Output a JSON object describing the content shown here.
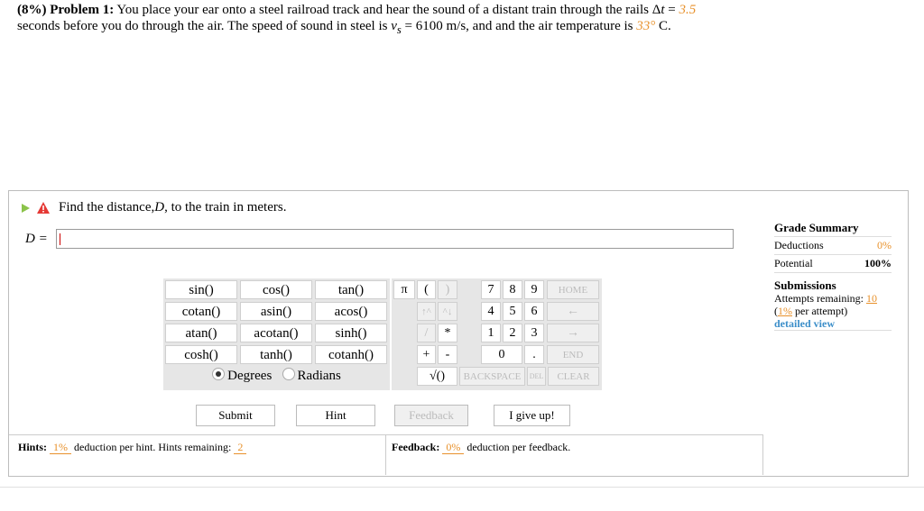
{
  "problem": {
    "weight": "(8%)",
    "label": "Problem 1:",
    "text1": "You place your ear onto a steel railroad track and hear the sound of a distant train through the rails Δ",
    "dt_var": "t",
    "eq1": " = ",
    "dt_value": "3.5",
    "text2": "seconds before you do through the air. The speed of sound in steel is ",
    "vs_var": "v",
    "vs_sub": "s",
    "text3": " = 6100 m/s, and and the air temperature is ",
    "temp_value": "33°",
    "text4": " C."
  },
  "question": {
    "text_before": "Find the distance, ",
    "var": "D",
    "text_after": ", to the train in meters.",
    "answer_label": "D =",
    "answer_value": ""
  },
  "grade_summary": {
    "title": "Grade Summary",
    "deductions_label": "Deductions",
    "deductions_value": "0%",
    "potential_label": "Potential",
    "potential_value": "100%"
  },
  "submissions": {
    "title": "Submissions",
    "attempts_label": "Attempts remaining:",
    "attempts_value": "10",
    "per_attempt_open": "(",
    "per_attempt_value": "1%",
    "per_attempt_rest": " per attempt)",
    "detail_link": "detailed view"
  },
  "functions": [
    [
      "sin()",
      "cos()",
      "tan()"
    ],
    [
      "cotan()",
      "asin()",
      "acos()"
    ],
    [
      "atan()",
      "acotan()",
      "sinh()"
    ],
    [
      "cosh()",
      "tanh()",
      "cotanh()"
    ]
  ],
  "angle_mode": {
    "degrees": "Degrees",
    "radians": "Radians",
    "selected": "Degrees"
  },
  "keypad": {
    "pi": "π",
    "lparen": "(",
    "rparen": ")",
    "up_arrows": "↑^",
    "down_arrows": "^↓",
    "slash": "/",
    "star": "*",
    "plus": "+",
    "minus": "-",
    "sqrt": "√()",
    "n7": "7",
    "n8": "8",
    "n9": "9",
    "n4": "4",
    "n5": "5",
    "n6": "6",
    "n1": "1",
    "n2": "2",
    "n3": "3",
    "n0": "0",
    "dot": ".",
    "home": "HOME",
    "left": "←",
    "right": "→",
    "end": "END",
    "backspace": "BACKSPACE",
    "del": "DEL",
    "clear": "CLEAR"
  },
  "actions": {
    "submit": "Submit",
    "hint": "Hint",
    "feedback": "Feedback",
    "give_up": "I give up!"
  },
  "hints": {
    "label": "Hints:",
    "percent": "1%",
    "mid": " deduction per hint. Hints remaining: ",
    "remaining": "2"
  },
  "feedback": {
    "label": "Feedback:",
    "percent": "0%",
    "rest": " deduction per feedback."
  },
  "colors": {
    "accent": "#e8912b",
    "link": "#3b8ec9",
    "pad_bg": "#e6e6e6"
  }
}
